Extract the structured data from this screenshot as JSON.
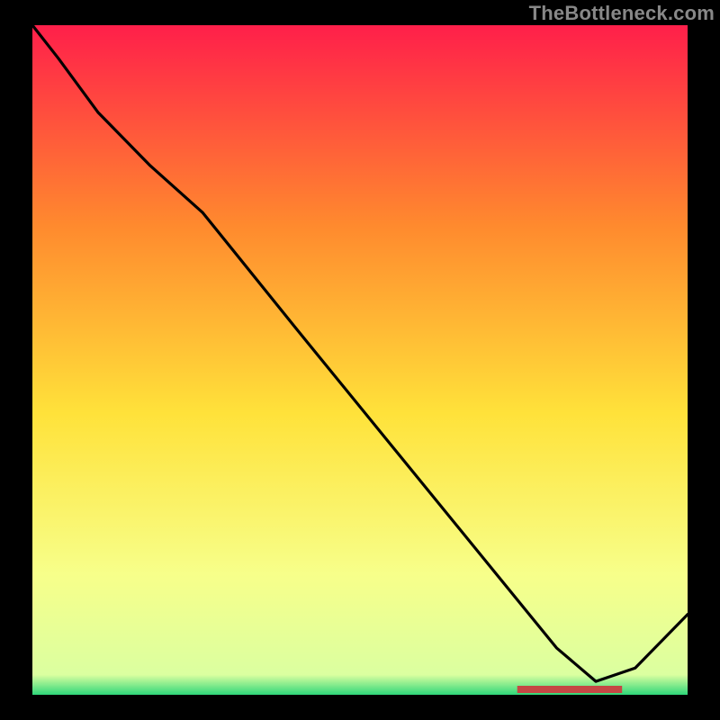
{
  "watermark": "TheBottleneck.com",
  "colors": {
    "background": "#000000",
    "topGradient": "#ff1f4a",
    "upperMid": "#ff8a2e",
    "mid": "#ffe23a",
    "lowerMid": "#f7ff8a",
    "bottom": "#2fd77a",
    "line": "#000000",
    "floorBar": "#c54744"
  },
  "chart_data": {
    "type": "line",
    "title": "",
    "xlabel": "",
    "ylabel": "",
    "xlim": [
      0,
      1
    ],
    "ylim": [
      0,
      1
    ],
    "x": [
      0.0,
      0.04,
      0.1,
      0.18,
      0.26,
      0.4,
      0.55,
      0.7,
      0.8,
      0.86,
      0.92,
      1.0
    ],
    "values": [
      1.0,
      0.95,
      0.87,
      0.79,
      0.72,
      0.55,
      0.37,
      0.19,
      0.07,
      0.02,
      0.04,
      0.12
    ],
    "minimum_region_x": [
      0.74,
      0.9
    ],
    "note": "x and y are normalized 0–1; no axis ticks or labels are rendered in the image"
  }
}
